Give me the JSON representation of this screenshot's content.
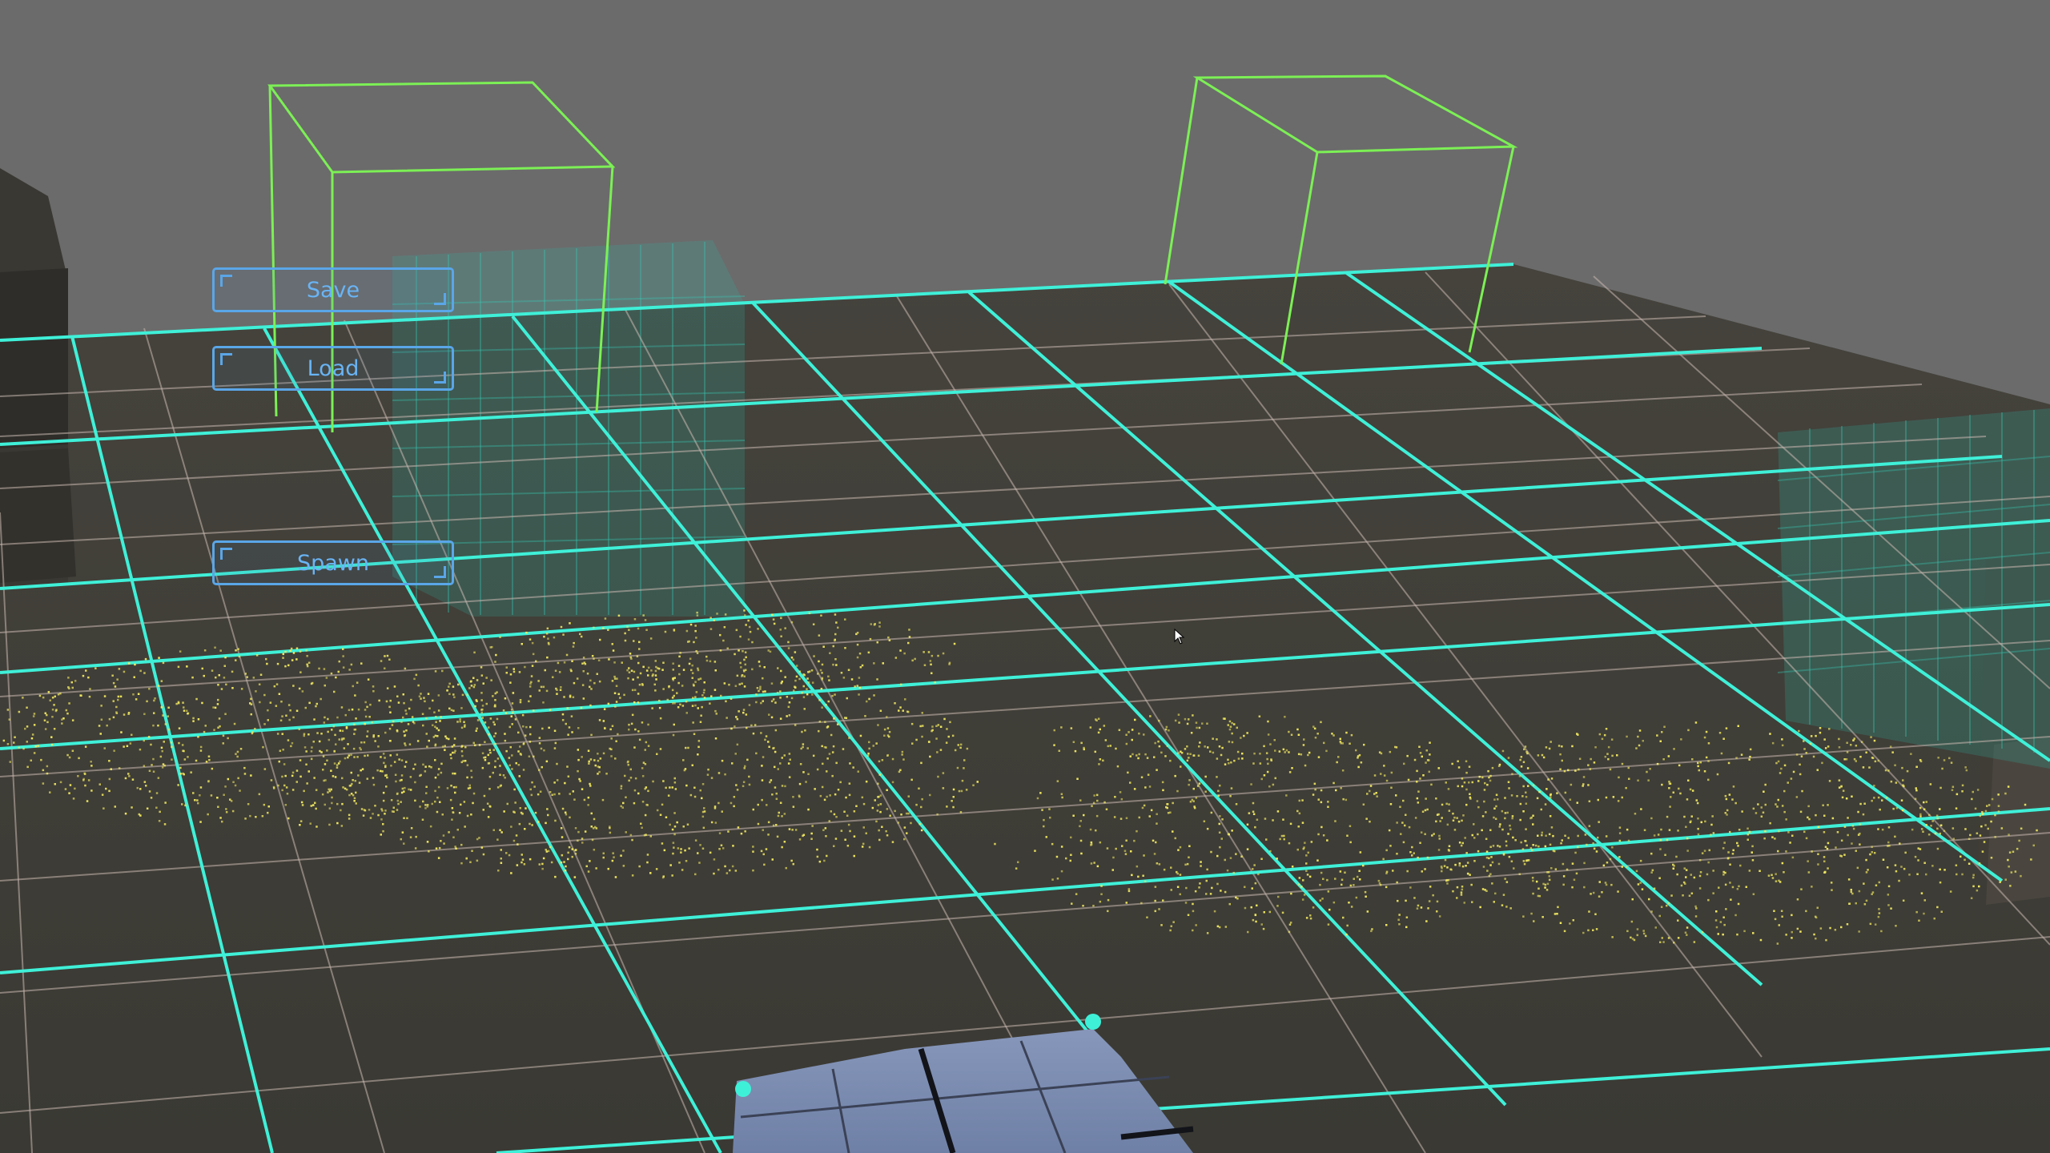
{
  "buttons": {
    "save": "Save",
    "load": "Load",
    "spawn": "Spawn"
  },
  "colors": {
    "sky": "#6a6a6a",
    "floor": "#3f3d37",
    "major_grid": "#3ff0d8",
    "minor_grid": "#c9b8b0",
    "wireframe": "#7cf055",
    "particles": "#f0e860",
    "button_accent": "#5aa6e8",
    "player_block": "#7a8cb0"
  },
  "icons": {
    "cursor": "arrow-cursor-icon",
    "corner": "bracket-corner-icon"
  }
}
